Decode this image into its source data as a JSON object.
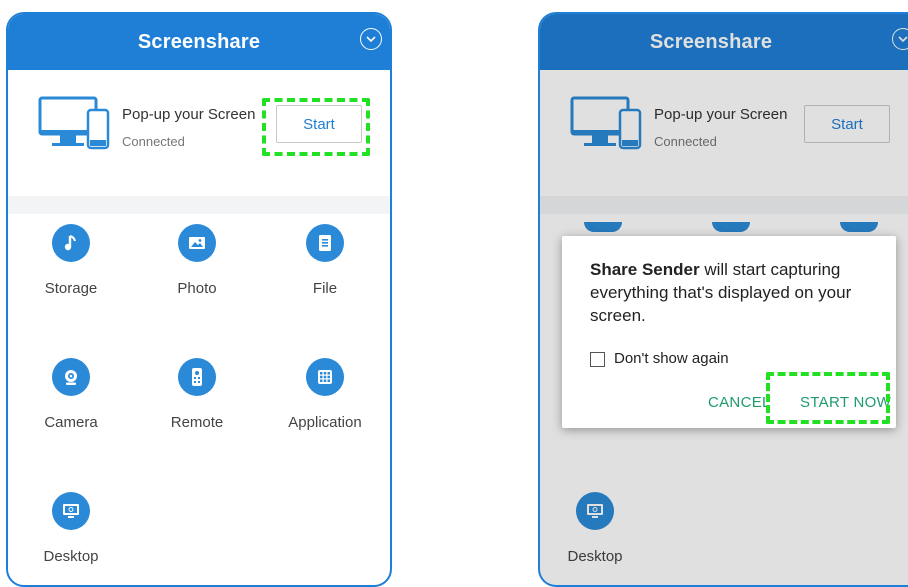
{
  "left_screen": {
    "title": "Screenshare",
    "pop_title": "Pop-up your Screen",
    "pop_status": "Connected",
    "start_label": "Start",
    "tiles": [
      {
        "label": "Storage",
        "icon": "music-note-icon"
      },
      {
        "label": "Photo",
        "icon": "image-icon"
      },
      {
        "label": "File",
        "icon": "file-icon"
      },
      {
        "label": "Camera",
        "icon": "webcam-icon"
      },
      {
        "label": "Remote",
        "icon": "remote-icon"
      },
      {
        "label": "Application",
        "icon": "grid-icon"
      },
      {
        "label": "Desktop",
        "icon": "monitor-icon"
      }
    ]
  },
  "right_screen": {
    "title": "Screenshare",
    "pop_title": "Pop-up your Screen",
    "pop_status": "Connected",
    "start_label": "Start",
    "dialog": {
      "app_name": "Share Sender",
      "message": " will start capturing everything that's displayed on your screen.",
      "checkbox_label": "Don't show again",
      "cancel_label": "CANCEL",
      "confirm_label": "START NOW"
    },
    "desktop_label": "Desktop"
  },
  "colors": {
    "brand_blue": "#1f7fd6",
    "highlight_green": "#22e022",
    "dialog_button": "#1e9b6c"
  }
}
